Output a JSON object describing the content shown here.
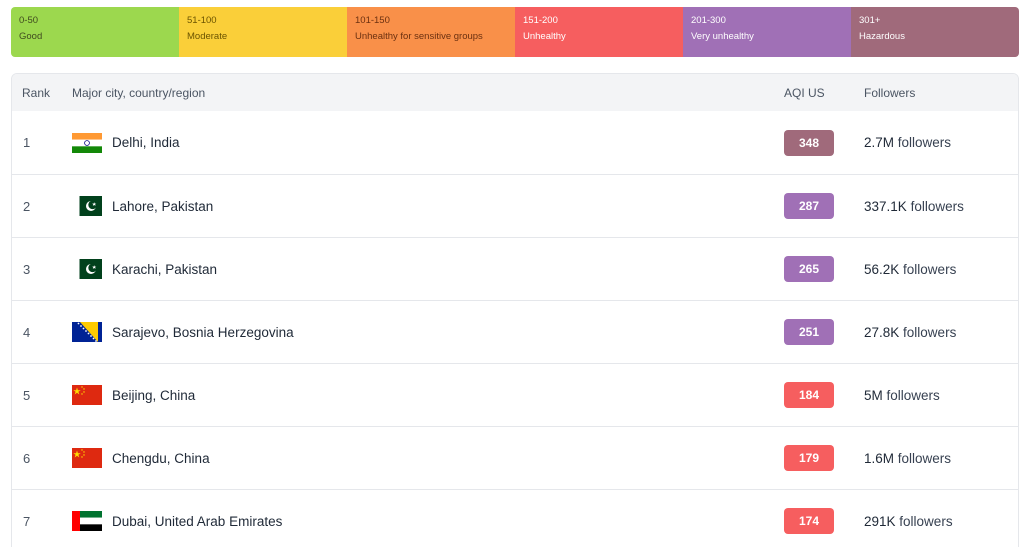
{
  "legend": [
    {
      "range": "0-50",
      "label": "Good",
      "bg": "#9cd84e",
      "fg": "#3f4a1f"
    },
    {
      "range": "51-100",
      "label": "Moderate",
      "bg": "#facf39",
      "fg": "#6b5400"
    },
    {
      "range": "101-150",
      "label": "Unhealthy for sensitive groups",
      "bg": "#f99049",
      "fg": "#6b3010"
    },
    {
      "range": "151-200",
      "label": "Unhealthy",
      "bg": "#f65e5f",
      "fg": "#ffffff"
    },
    {
      "range": "201-300",
      "label": "Very unhealthy",
      "bg": "#a070b6",
      "fg": "#ffffff"
    },
    {
      "range": "301+",
      "label": "Hazardous",
      "bg": "#a06a7b",
      "fg": "#ffffff"
    }
  ],
  "table": {
    "headers": {
      "rank": "Rank",
      "city": "Major city, country/region",
      "aqi": "AQI US",
      "followers": "Followers"
    },
    "rows": [
      {
        "rank": "1",
        "city": "Delhi, India",
        "flag": "india-flag-icon",
        "aqi": "348",
        "aqi_color": "#a06a7b",
        "followers_count": "2.7M",
        "followers_word": "followers"
      },
      {
        "rank": "2",
        "city": "Lahore, Pakistan",
        "flag": "pakistan-flag-icon",
        "aqi": "287",
        "aqi_color": "#a070b6",
        "followers_count": "337.1K",
        "followers_word": "followers"
      },
      {
        "rank": "3",
        "city": "Karachi, Pakistan",
        "flag": "pakistan-flag-icon",
        "aqi": "265",
        "aqi_color": "#a070b6",
        "followers_count": "56.2K",
        "followers_word": "followers"
      },
      {
        "rank": "4",
        "city": "Sarajevo, Bosnia Herzegovina",
        "flag": "bosnia-flag-icon",
        "aqi": "251",
        "aqi_color": "#a070b6",
        "followers_count": "27.8K",
        "followers_word": "followers"
      },
      {
        "rank": "5",
        "city": "Beijing, China",
        "flag": "china-flag-icon",
        "aqi": "184",
        "aqi_color": "#f65e5f",
        "followers_count": "5M",
        "followers_word": "followers"
      },
      {
        "rank": "6",
        "city": "Chengdu, China",
        "flag": "china-flag-icon",
        "aqi": "179",
        "aqi_color": "#f65e5f",
        "followers_count": "1.6M",
        "followers_word": "followers"
      },
      {
        "rank": "7",
        "city": "Dubai, United Arab Emirates",
        "flag": "uae-flag-icon",
        "aqi": "174",
        "aqi_color": "#f65e5f",
        "followers_count": "291K",
        "followers_word": "followers"
      }
    ]
  }
}
